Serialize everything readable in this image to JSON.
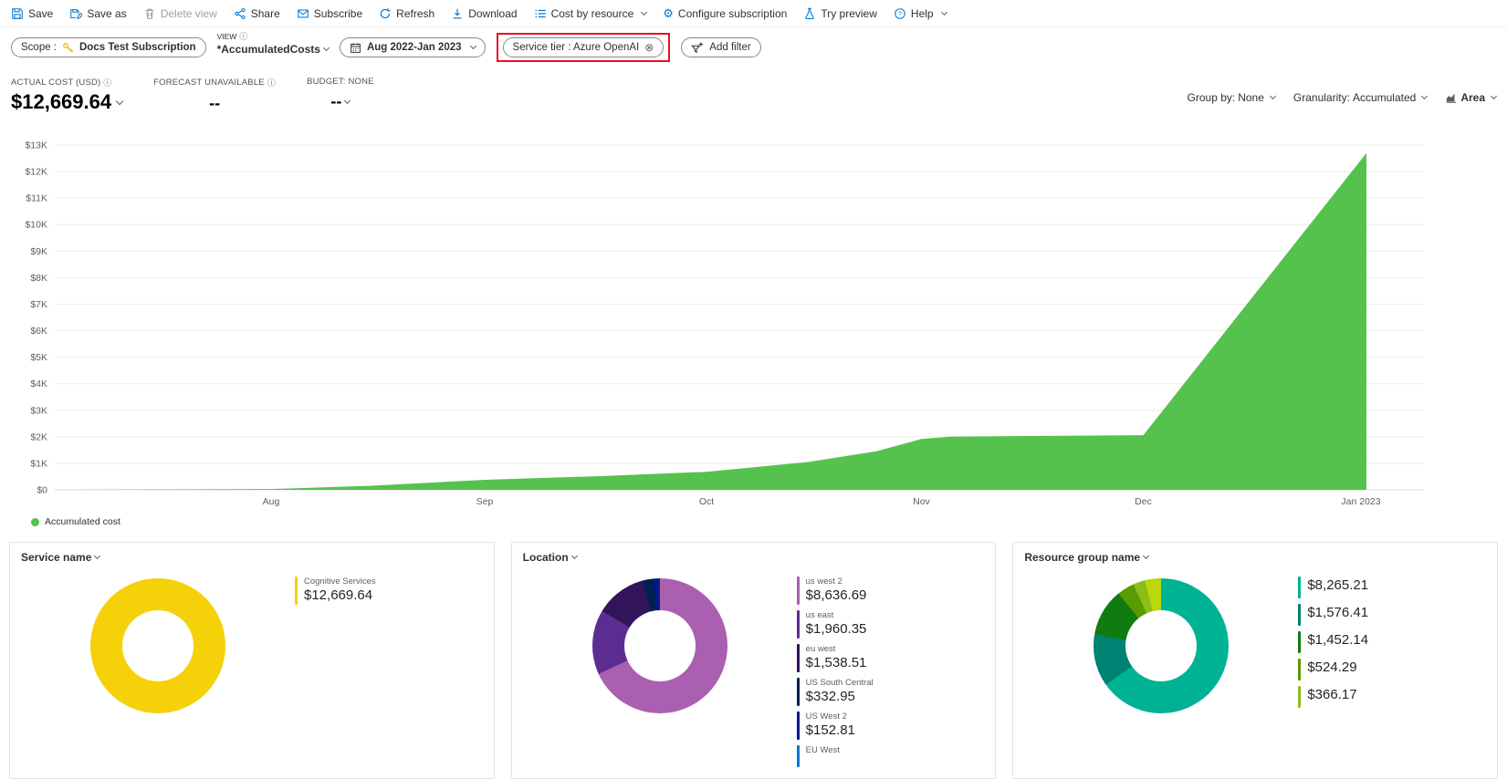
{
  "toolbar": {
    "items": [
      {
        "label": "Save"
      },
      {
        "label": "Save as"
      },
      {
        "label": "Delete view",
        "disabled": true
      },
      {
        "label": "Share"
      },
      {
        "label": "Subscribe"
      },
      {
        "label": "Refresh"
      },
      {
        "label": "Download"
      },
      {
        "label": "Cost by resource",
        "has_menu": true
      },
      {
        "label": "Configure subscription"
      },
      {
        "label": "Try preview"
      },
      {
        "label": "Help",
        "has_menu": true
      }
    ]
  },
  "filter_bar": {
    "scope": {
      "label": "Scope :",
      "value": "Docs Test Subscription"
    },
    "view": {
      "label": "VIEW",
      "value": "*AccumulatedCosts"
    },
    "date_range": {
      "value": "Aug 2022-Jan 2023"
    },
    "filter_pill": {
      "label": "Service tier : Azure OpenAI",
      "highlight_color": "#e81123"
    },
    "add_filter": {
      "label": "Add filter"
    }
  },
  "kpis": {
    "actual": {
      "label": "ACTUAL COST (USD)",
      "value": "$12,669.64"
    },
    "forecast": {
      "label": "FORECAST UNAVAILABLE",
      "value": "--"
    },
    "budget": {
      "label": "BUDGET: NONE",
      "value": "--"
    }
  },
  "chart_controls": {
    "group_by": {
      "label": "Group by:",
      "value": "None"
    },
    "granularity": {
      "label": "Granularity:",
      "value": "Accumulated"
    },
    "chart_type": {
      "value": "Area"
    }
  },
  "legend": {
    "label": "Accumulated cost",
    "color": "#55c24e"
  },
  "chart_data": [
    {
      "type": "area",
      "title": "Accumulated cost",
      "color": "#55c24e",
      "ylim": [
        0,
        13000
      ],
      "y_tick_step": 1000,
      "x_ticks": [
        {
          "label": "Aug",
          "f": 0.158
        },
        {
          "label": "Sep",
          "f": 0.314
        },
        {
          "label": "Oct",
          "f": 0.476
        },
        {
          "label": "Nov",
          "f": 0.633
        },
        {
          "label": "Dec",
          "f": 0.795
        },
        {
          "label": "Jan 2023",
          "f": 0.954
        }
      ],
      "points": [
        [
          0,
          0
        ],
        [
          0.158,
          30
        ],
        [
          0.23,
          150
        ],
        [
          0.314,
          380
        ],
        [
          0.4,
          520
        ],
        [
          0.476,
          680
        ],
        [
          0.55,
          1050
        ],
        [
          0.6,
          1450
        ],
        [
          0.633,
          1920
        ],
        [
          0.655,
          2010
        ],
        [
          0.795,
          2060
        ],
        [
          0.958,
          12700
        ]
      ],
      "grid": true,
      "legend_position": "bottom-left"
    },
    {
      "type": "pie",
      "title": "Service name",
      "total": 12669.64,
      "segments": [
        {
          "label": "Cognitive Services",
          "value": 12669.64,
          "color": "#f5d109"
        }
      ]
    },
    {
      "type": "pie",
      "title": "Location",
      "total": 12669.64,
      "segments": [
        {
          "label": "us west 2",
          "value": 8636.69,
          "color": "#aa5fb0"
        },
        {
          "label": "us east",
          "value": 1960.35,
          "color": "#5c2d91"
        },
        {
          "label": "eu west",
          "value": 1538.51,
          "color": "#32145a"
        },
        {
          "label": "US South Central",
          "value": 332.95,
          "color": "#002050"
        },
        {
          "label": "US West 2",
          "value": 152.81,
          "color": "#00188f"
        }
      ],
      "remainder_color": "#201f5e"
    },
    {
      "type": "pie",
      "title": "Resource group name",
      "total": 12669.64,
      "segments": [
        {
          "label": "",
          "value": 8265.21,
          "color": "#00b294"
        },
        {
          "label": "",
          "value": 1576.41,
          "color": "#008272"
        },
        {
          "label": "",
          "value": 1452.14,
          "color": "#107c10"
        },
        {
          "label": "",
          "value": 524.29,
          "color": "#599b00"
        },
        {
          "label": "",
          "value": 366.17,
          "color": "#8cbd18"
        }
      ],
      "remainder_color": "#bad80a"
    }
  ],
  "cards": [
    {
      "title": "Service name",
      "legend": [
        {
          "name": "Cognitive Services",
          "value": "$12,669.64",
          "color": "#f5d109"
        }
      ]
    },
    {
      "title": "Location",
      "legend": [
        {
          "name": "us west 2",
          "value": "$8,636.69",
          "color": "#aa5fb0"
        },
        {
          "name": "us east",
          "value": "$1,960.35",
          "color": "#5c2d91"
        },
        {
          "name": "eu west",
          "value": "$1,538.51",
          "color": "#32145a"
        },
        {
          "name": "US South Central",
          "value": "$332.95",
          "color": "#002050"
        },
        {
          "name": "US West 2",
          "value": "$152.81",
          "color": "#00188f"
        },
        {
          "name": "EU West",
          "value": "",
          "color": "#0078d4"
        }
      ]
    },
    {
      "title": "Resource group name",
      "legend": [
        {
          "name": "",
          "value": "$8,265.21",
          "color": "#00b294"
        },
        {
          "name": "",
          "value": "$1,576.41",
          "color": "#008272"
        },
        {
          "name": "",
          "value": "$1,452.14",
          "color": "#107c10"
        },
        {
          "name": "",
          "value": "$524.29",
          "color": "#599b00"
        },
        {
          "name": "",
          "value": "$366.17",
          "color": "#8cbd18"
        }
      ]
    }
  ]
}
